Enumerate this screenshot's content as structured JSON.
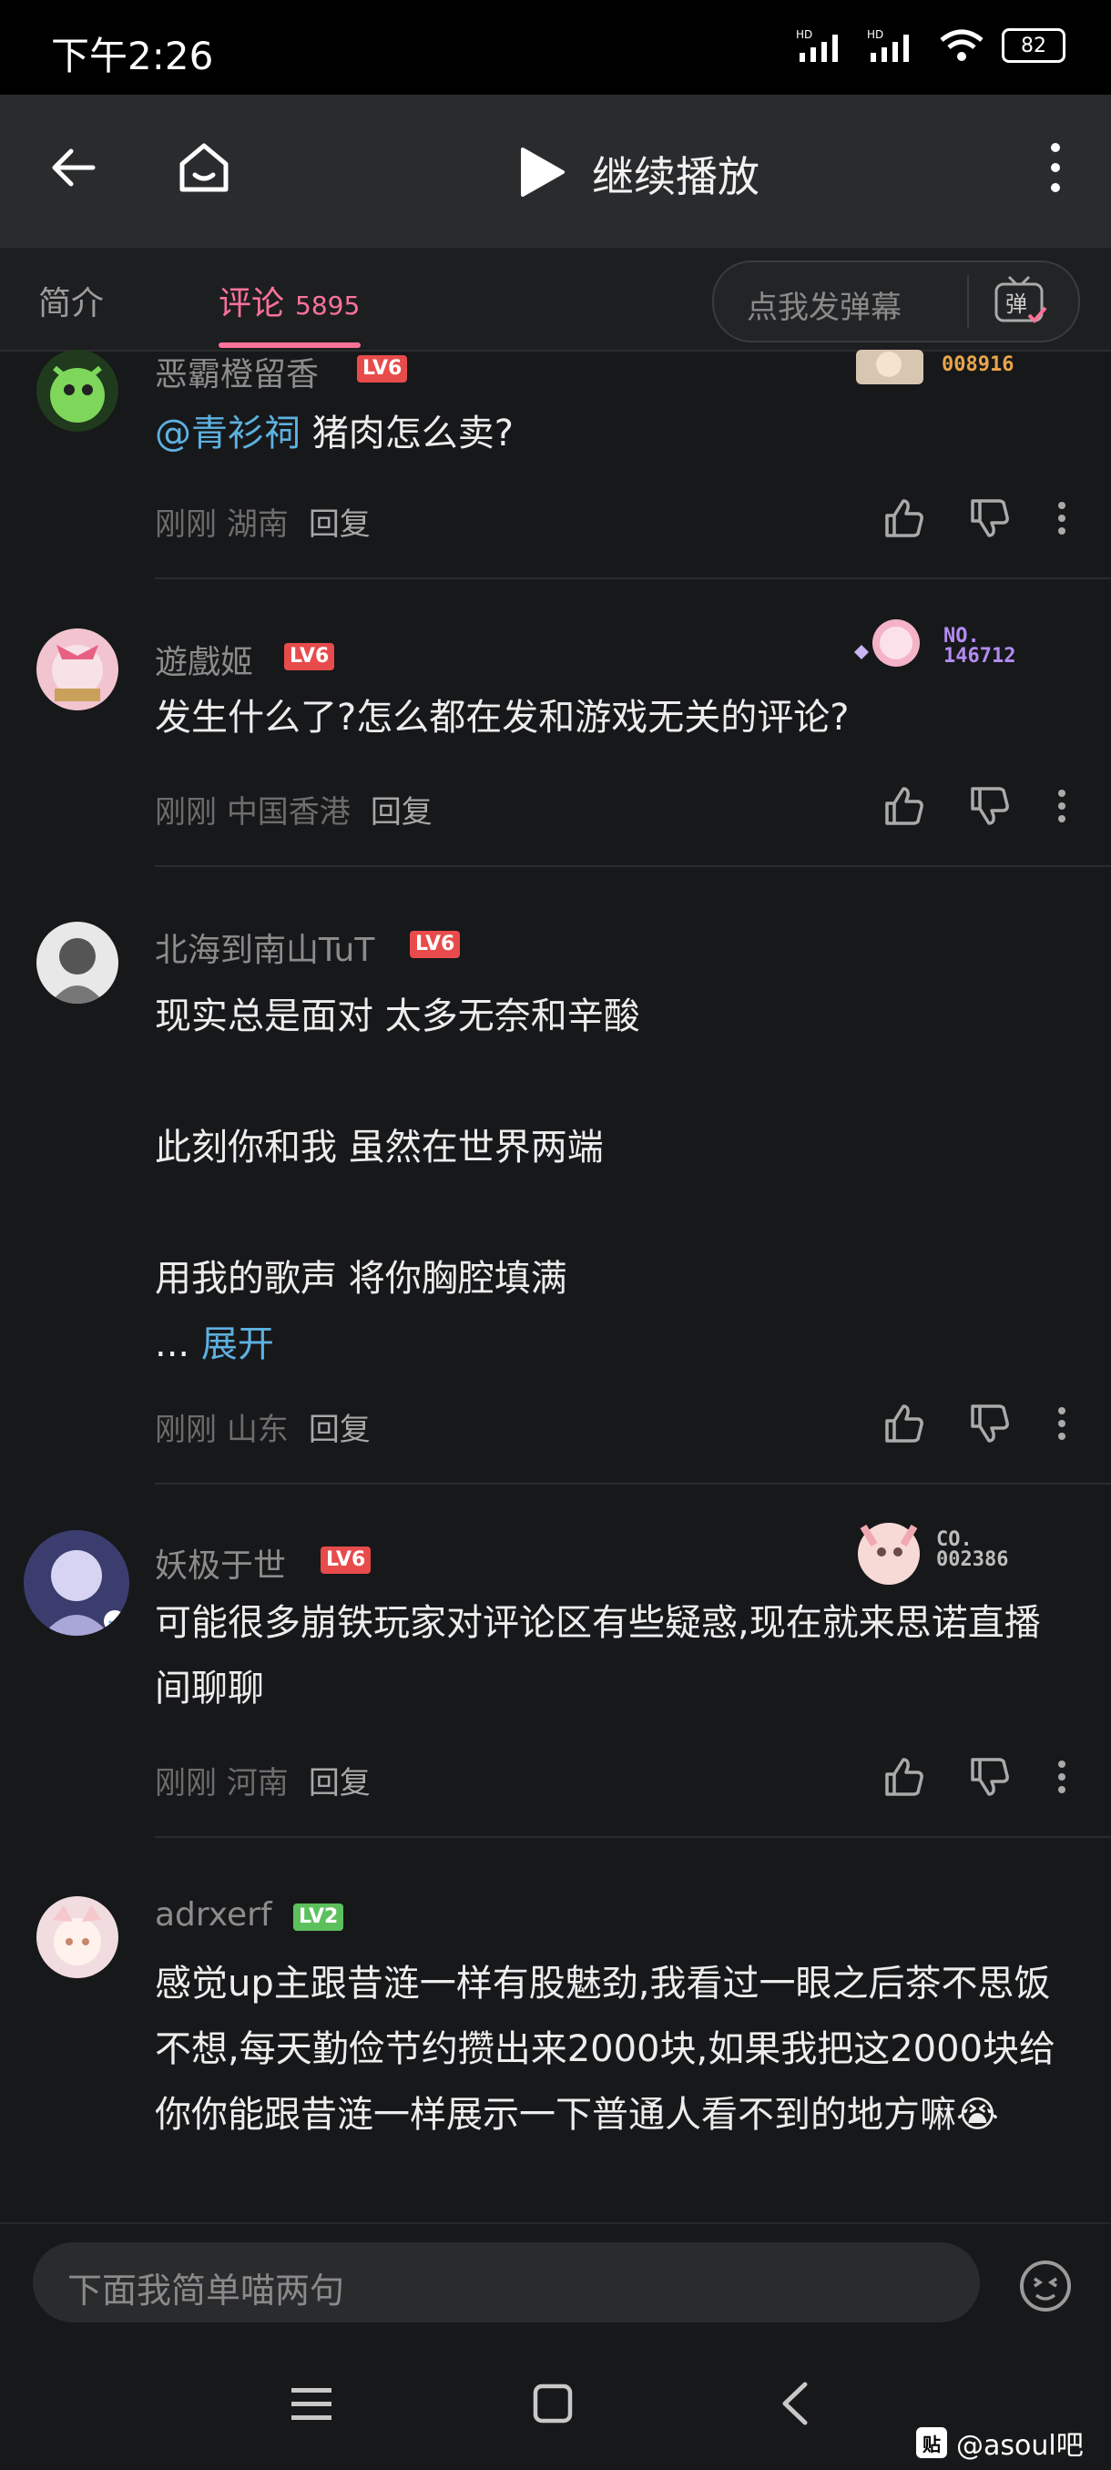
{
  "status_bar": {
    "time": "下午2:26",
    "battery": "82",
    "network_1": "HD",
    "network_2": "HD"
  },
  "header": {
    "continue_label": "继续播放"
  },
  "tabs": {
    "intro": "简介",
    "comments": "评论",
    "comments_count": "5895",
    "danmaku_placeholder": "点我发弹幕",
    "danmaku_icon_text": "弹"
  },
  "comments": [
    {
      "username": "恶霸橙留香",
      "level": "LV6",
      "badge_number": "008916",
      "badge_prefix": "",
      "mention": "@青衫祠",
      "text": " 猪肉怎么卖?",
      "time": "刚刚",
      "location": "湖南",
      "reply": "回复"
    },
    {
      "username": "遊戲姬",
      "level": "LV6",
      "badge_prefix": "NO.",
      "badge_number": "146712",
      "text": "发生什么了?怎么都在发和游戏无关的评论?",
      "time": "刚刚",
      "location": "中国香港",
      "reply": "回复"
    },
    {
      "username": "北海到南山TuT",
      "level": "LV6",
      "lines": [
        "现实总是面对 太多无奈和辛酸",
        "此刻你和我 虽然在世界两端",
        "用我的歌声 将你胸腔填满"
      ],
      "ellipsis": "...",
      "expand": "展开",
      "time": "刚刚",
      "location": "山东",
      "reply": "回复"
    },
    {
      "username": "妖极于世",
      "level": "LV6",
      "badge_prefix": "CO.",
      "badge_number": "002386",
      "text": "可能很多崩铁玩家对评论区有些疑惑,现在就来思诺直播间聊聊",
      "time": "刚刚",
      "location": "河南",
      "reply": "回复"
    },
    {
      "username": "adrxerf",
      "level": "LV2",
      "text": "感觉up主跟昔涟一样有股魅劲,我看过一眼之后茶不思饭不想,每天勤俭节约攒出来2000块,如果我把这2000块给你你能跟昔涟一样展示一下普通人看不到的地方嘛😭"
    }
  ],
  "input": {
    "placeholder": "下面我简单喵两句"
  },
  "watermark": {
    "logo": "贴",
    "text": "@asoul吧"
  },
  "colors": {
    "accent": "#fb7299",
    "link": "#5db1e0",
    "background": "#17181a"
  },
  "icons": [
    "back-arrow-icon",
    "home-icon",
    "play-icon",
    "more-vertical-icon",
    "thumb-up-icon",
    "thumb-down-icon",
    "emoji-icon",
    "menu-icon",
    "square-icon",
    "nav-back-icon"
  ]
}
